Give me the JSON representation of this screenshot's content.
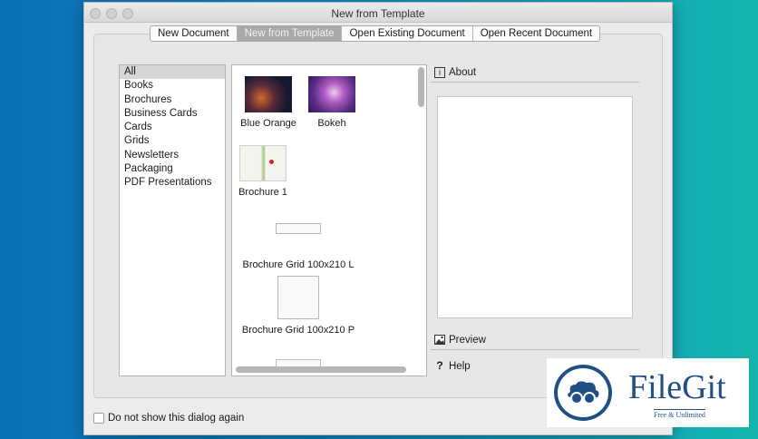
{
  "window": {
    "title": "New from Template"
  },
  "tabs": [
    {
      "label": "New Document"
    },
    {
      "label": "New from Template"
    },
    {
      "label": "Open Existing Document"
    },
    {
      "label": "Open Recent Document"
    }
  ],
  "tabs_active_index": 1,
  "categories": [
    "All",
    "Books",
    "Brochures",
    "Business Cards",
    "Cards",
    "Grids",
    "Newsletters",
    "Packaging",
    "PDF Presentations"
  ],
  "categories_selected_index": 0,
  "templates": [
    {
      "label": "Blue Orange",
      "thumb": "blue-orange"
    },
    {
      "label": "Bokeh",
      "thumb": "bokeh"
    },
    {
      "label": "Brochure 1",
      "thumb": "brochure"
    },
    {
      "label": "Brochure Grid 100x210 L",
      "thumb": "grid-landscape"
    },
    {
      "label": "Brochure Grid 100x210 P",
      "thumb": "grid-portrait"
    }
  ],
  "side_panels": {
    "about": {
      "label": "About",
      "icon": "info-icon"
    },
    "preview": {
      "label": "Preview",
      "icon": "image-icon"
    },
    "help": {
      "label": "Help",
      "icon": "question-icon"
    }
  },
  "footer": {
    "checkbox_label": "Do not show this dialog again",
    "checked": false
  },
  "watermark": {
    "brand": "FileGit",
    "tagline": "Free & Unlimited"
  }
}
